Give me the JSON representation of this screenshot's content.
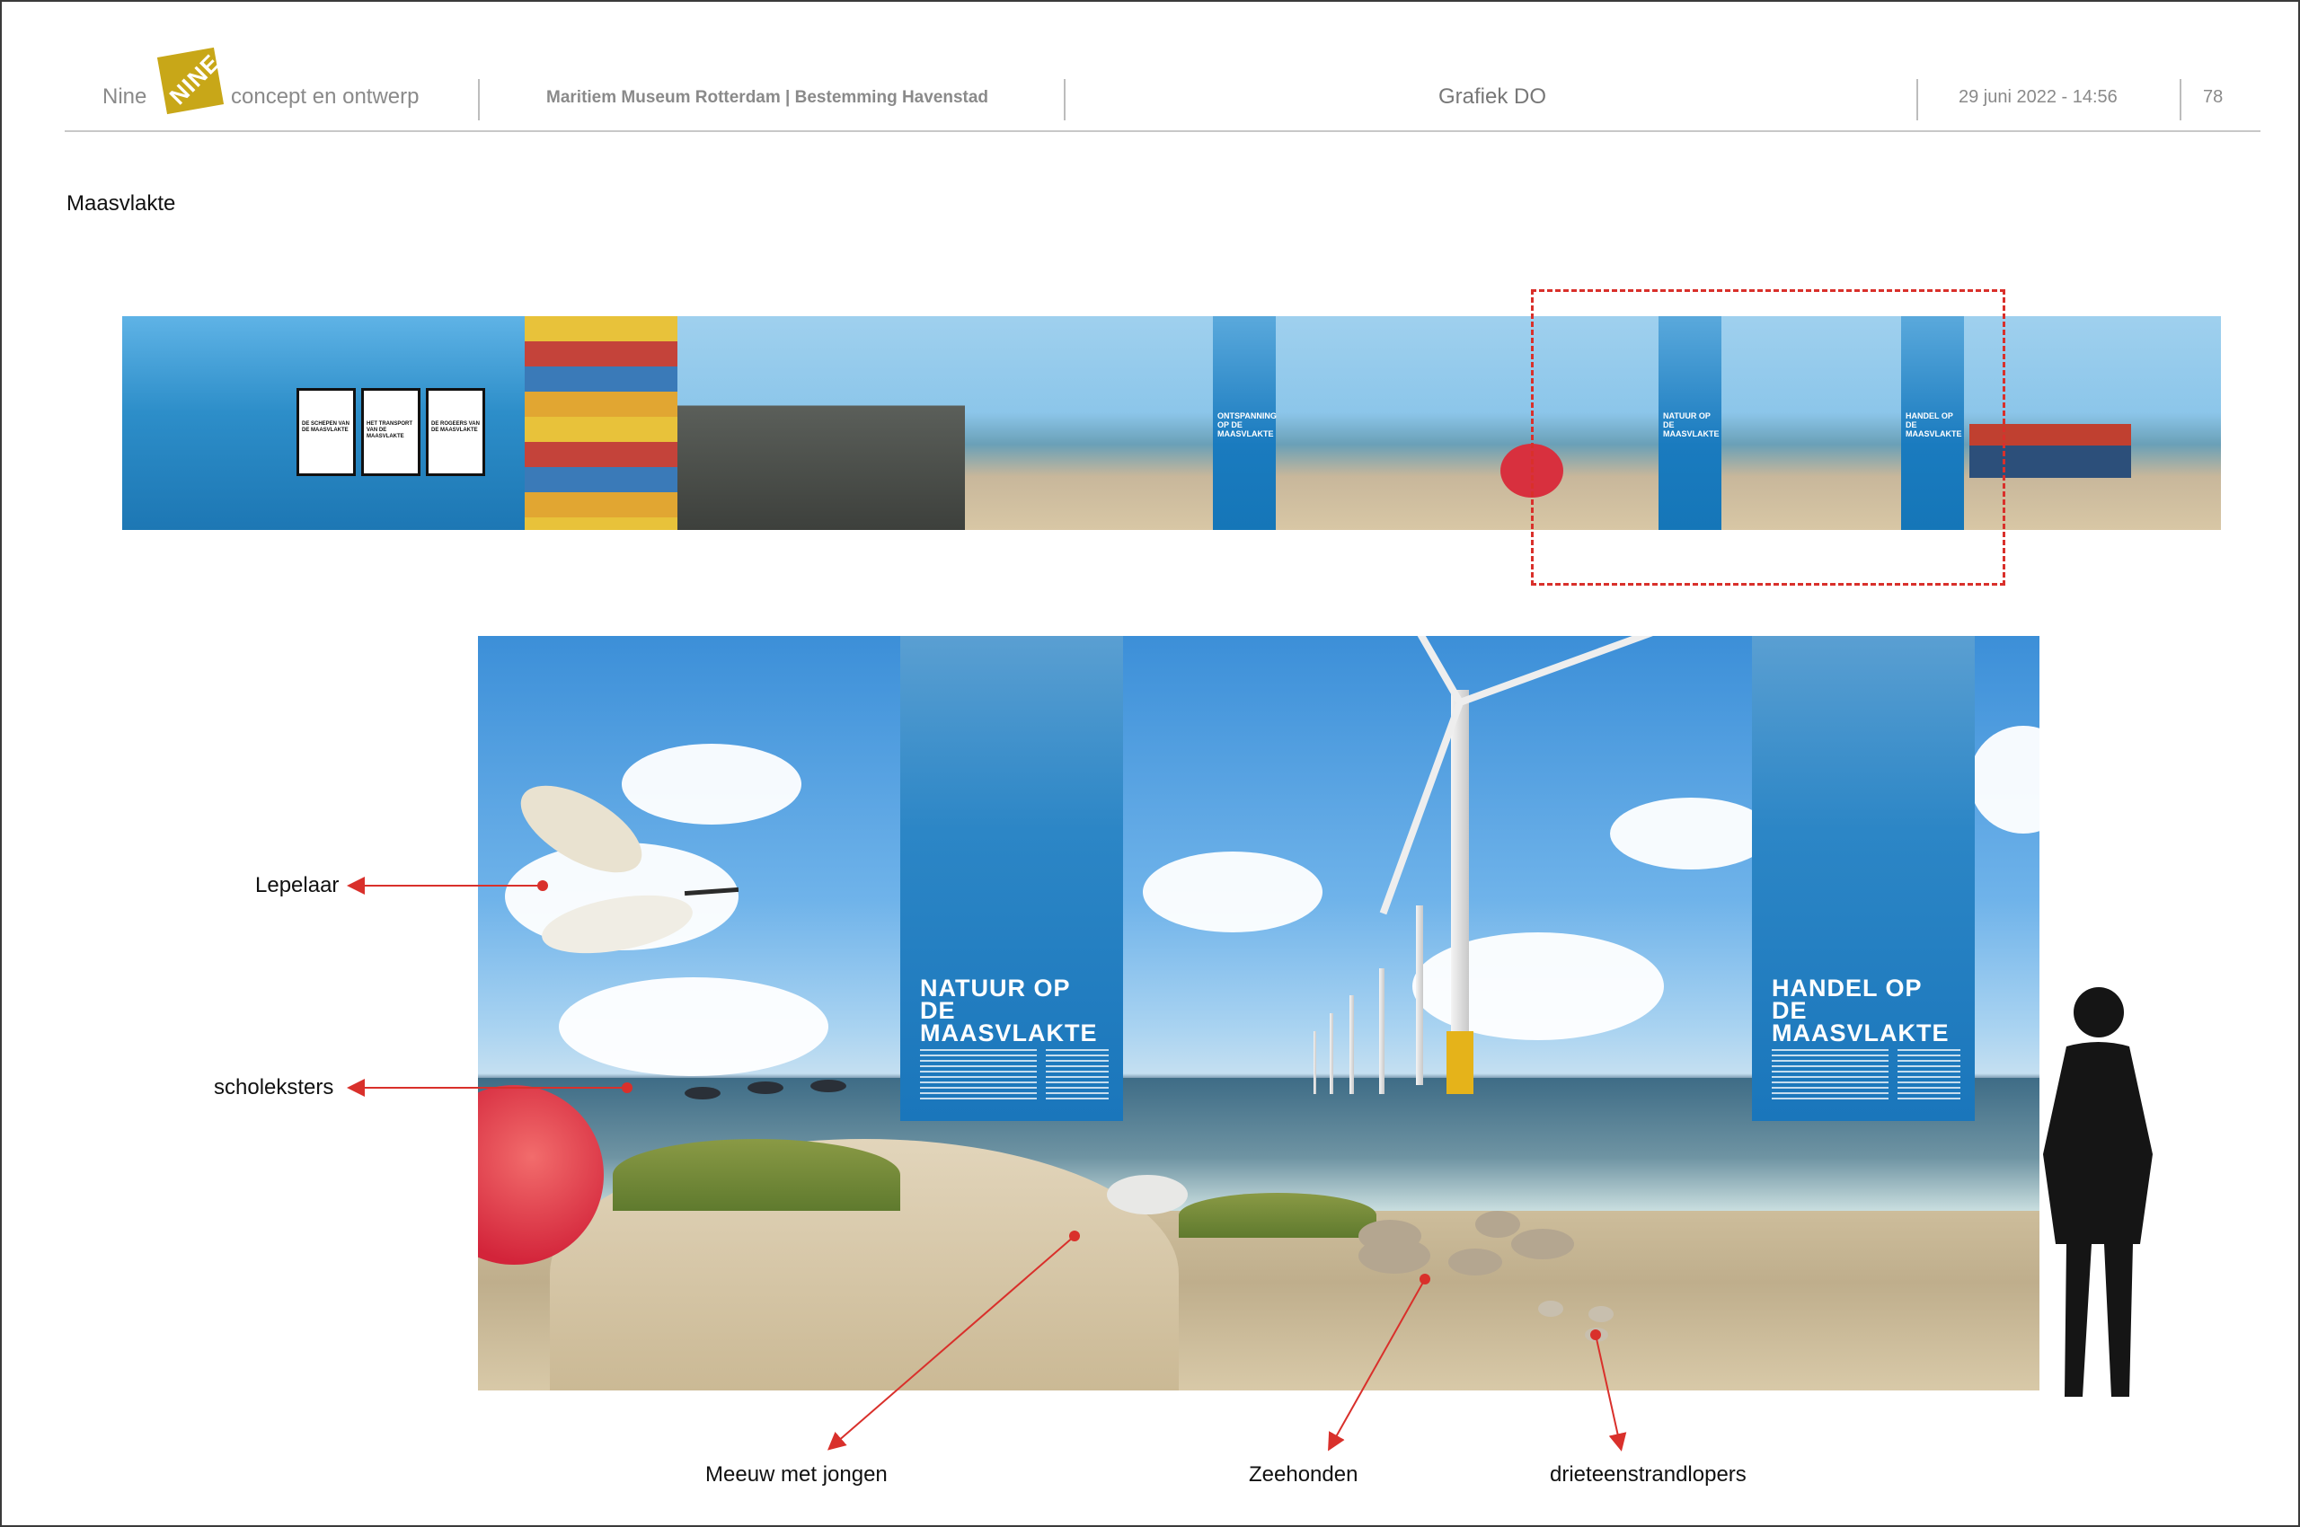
{
  "header": {
    "brand_left": "Nine",
    "logo_text": "NINE",
    "brand_right": "concept en ontwerp",
    "project": "Maritiem Museum Rotterdam | Bestemming Havenstad",
    "document": "Grafiek DO",
    "date": "29 juni 2022 - 14:56",
    "page": "78"
  },
  "section_title": "Maasvlakte",
  "overview": {
    "stand_titles": [
      "DE SCHEPEN VAN DE MAASVLAKTE",
      "HET TRANSPORT VAN DE MAASVLAKTE",
      "DE ROGEERS VAN DE MAASVLAKTE"
    ],
    "panels": [
      "ONTSPANNING OP DE MAASVLAKTE",
      "NATUUR OP DE MAASVLAKTE",
      "HANDEL OP DE MAASVLAKTE"
    ]
  },
  "detail": {
    "panel_left_title": "NATUUR OP DE MAASVLAKTE",
    "panel_right_title": "HANDEL OP DE MAASVLAKTE"
  },
  "annotations": {
    "lepelaar": "Lepelaar",
    "scholeksters": "scholeksters",
    "meeuw": "Meeuw met jongen",
    "zeehonden": "Zeehonden",
    "strandlopers": "drieteenstrandlopers"
  },
  "colors": {
    "accent_red": "#d9302b",
    "panel_blue": "#1a76bb",
    "logo_gold": "#c8a718"
  }
}
